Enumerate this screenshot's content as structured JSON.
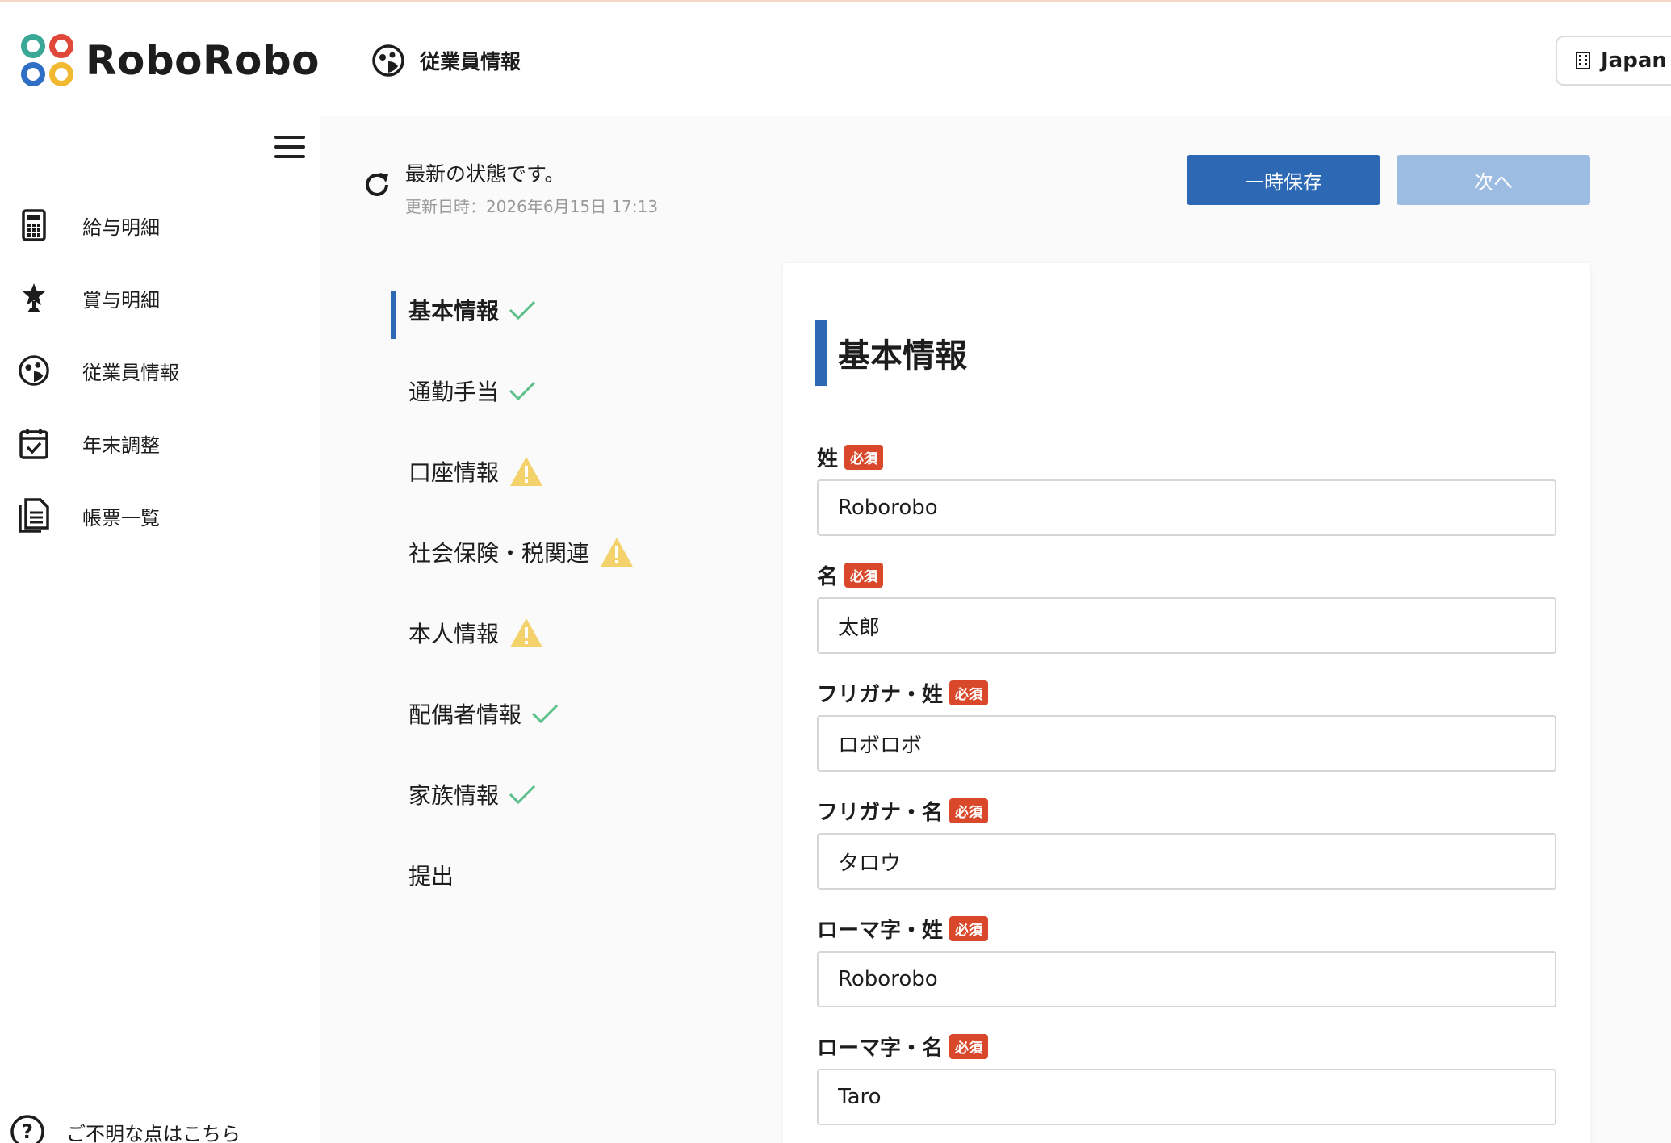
{
  "header": {
    "logo_text": "RoboRobo",
    "page_title": "従業員情報",
    "company_name": "Japan I"
  },
  "sidebar": {
    "items": [
      {
        "label": "給与明細",
        "icon": "calculator-icon"
      },
      {
        "label": "賞与明細",
        "icon": "trophy-star-icon"
      },
      {
        "label": "従業員情報",
        "icon": "employee-face-icon"
      },
      {
        "label": "年末調整",
        "icon": "calendar-check-icon"
      },
      {
        "label": "帳票一覧",
        "icon": "documents-icon"
      }
    ],
    "help_label": "ご不明な点はこちら"
  },
  "status": {
    "message": "最新の状態です。",
    "updated_at": "更新日時：2026年6月15日 17:13"
  },
  "toolbar": {
    "save_label": "一時保存",
    "next_label": "次へ"
  },
  "steps": [
    {
      "label": "基本情報",
      "state": "complete"
    },
    {
      "label": "通勤手当",
      "state": "complete"
    },
    {
      "label": "口座情報",
      "state": "warning"
    },
    {
      "label": "社会保険・税関連",
      "state": "warning"
    },
    {
      "label": "本人情報",
      "state": "warning"
    },
    {
      "label": "配偶者情報",
      "state": "complete"
    },
    {
      "label": "家族情報",
      "state": "complete"
    },
    {
      "label": "提出",
      "state": "none"
    }
  ],
  "form": {
    "title": "基本情報",
    "required_badge": "必須",
    "fields": [
      {
        "label": "姓",
        "value": "Roborobo"
      },
      {
        "label": "名",
        "value": "太郎"
      },
      {
        "label": "フリガナ・姓",
        "value": "ロボロボ"
      },
      {
        "label": "フリガナ・名",
        "value": "タロウ"
      },
      {
        "label": "ローマ字・姓",
        "value": "Roborobo"
      },
      {
        "label": "ローマ字・名",
        "value": "Taro"
      }
    ]
  },
  "colors": {
    "primary": "#2c68b3",
    "primary_disabled": "#9dbce2",
    "required_badge": "#d9482b",
    "check": "#5bbf8a",
    "warning": "#f4d26b"
  }
}
